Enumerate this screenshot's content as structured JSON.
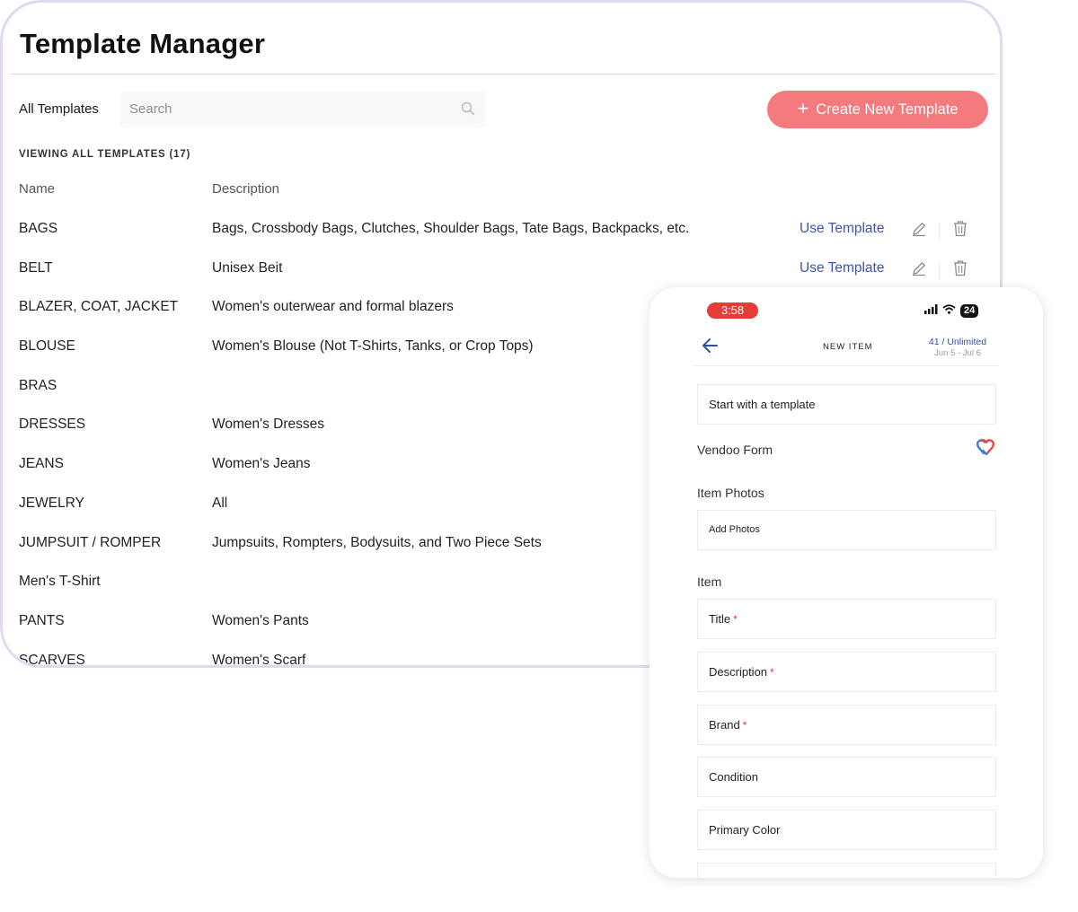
{
  "desktop": {
    "title": "Template Manager",
    "filter_label": "All Templates",
    "search_placeholder": "Search",
    "create_button": "Create New Template",
    "viewing_label": "VIEWING ALL TEMPLATES (17)",
    "columns": {
      "name": "Name",
      "description": "Description"
    },
    "action_label": "Use Template",
    "rows": [
      {
        "name": "BAGS",
        "description": "Bags, Crossbody Bags, Clutches, Shoulder Bags, Tate Bags, Backpacks, etc."
      },
      {
        "name": "BELT",
        "description": "Unisex Beit"
      },
      {
        "name": "BLAZER, COAT, JACKET",
        "description": "Women's outerwear and formal blazers"
      },
      {
        "name": "BLOUSE",
        "description": "Women's Blouse (Not T-Shirts, Tanks, or Crop Tops)"
      },
      {
        "name": "BRAS",
        "description": ""
      },
      {
        "name": "DRESSES",
        "description": "Women's Dresses"
      },
      {
        "name": "JEANS",
        "description": "Women's Jeans"
      },
      {
        "name": "JEWELRY",
        "description": "All"
      },
      {
        "name": "JUMPSUIT / ROMPER",
        "description": "Jumpsuits, Rompters, Bodysuits, and Two Piece Sets"
      },
      {
        "name": "Men's T-Shirt",
        "description": ""
      },
      {
        "name": "PANTS",
        "description": "Women's Pants"
      },
      {
        "name": "SCARVES",
        "description": "Women's Scarf"
      }
    ]
  },
  "phone": {
    "time": "3:58",
    "battery": "24",
    "nav_title": "NEW ITEM",
    "usage_count": "41 / Unlimited",
    "usage_range": "Jun 5 - Jul 6",
    "template_box": "Start with a template",
    "vendoo_form": "Vendoo Form",
    "photos_label": "Item Photos",
    "add_photos": "Add Photos",
    "item_label": "Item",
    "fields": {
      "title": "Title",
      "description": "Description",
      "brand": "Brand",
      "condition": "Condition",
      "primary_color": "Primary Color"
    },
    "required_mark": "*"
  },
  "colors": {
    "accent": "#f47a7e",
    "link": "#3e55a8",
    "time_pill": "#e53d36",
    "panel_border": "#e2d9ef"
  }
}
